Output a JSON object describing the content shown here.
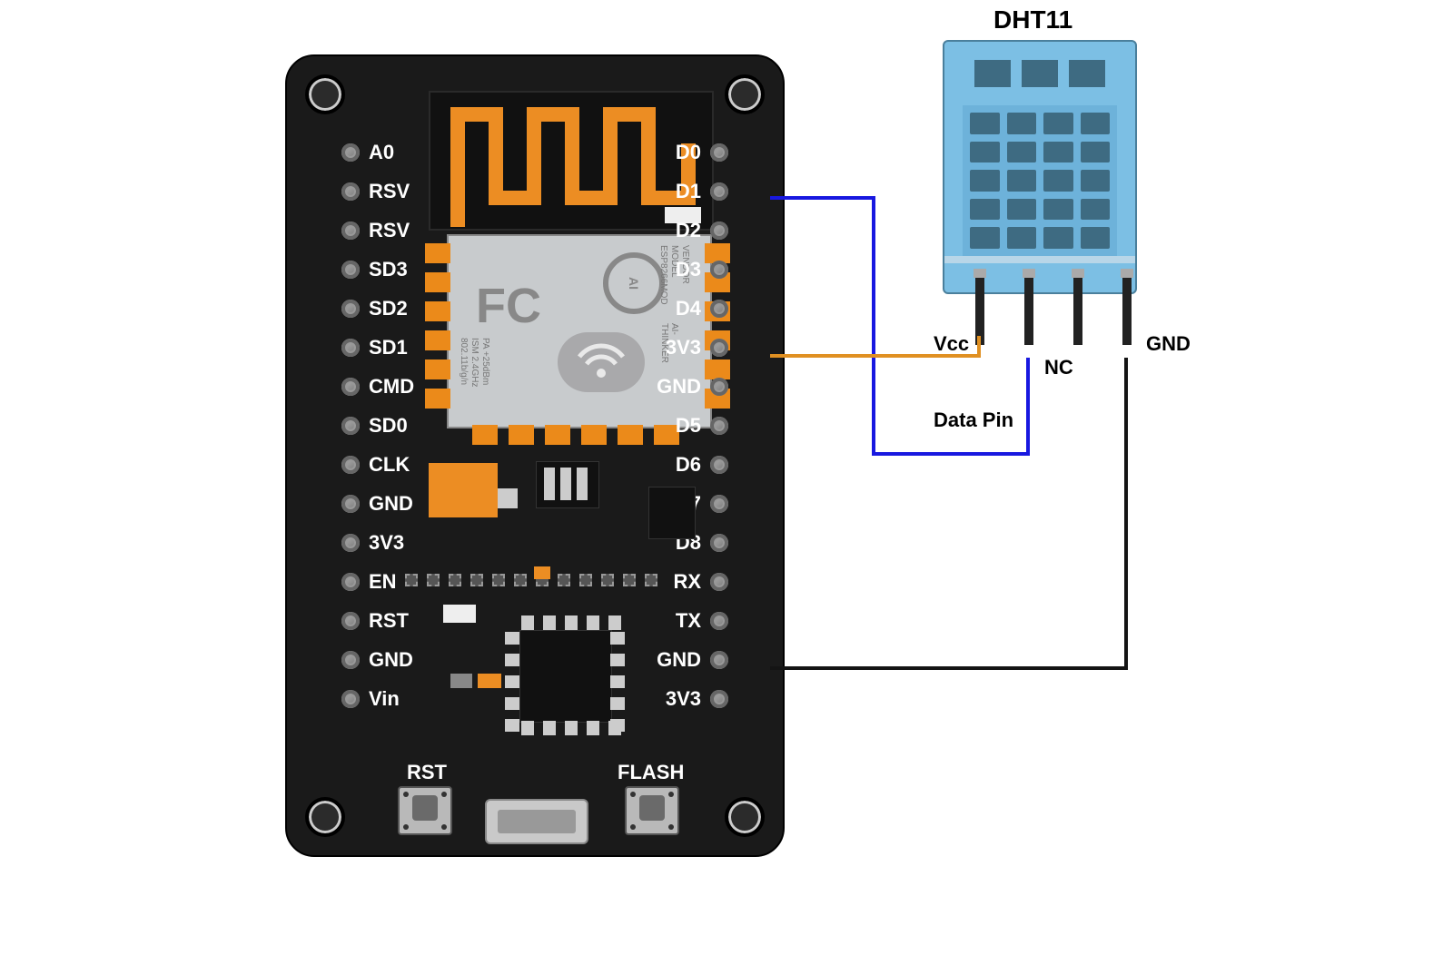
{
  "dht": {
    "title": "DHT11",
    "pins": [
      "Vcc",
      "Data",
      "NC",
      "GND"
    ]
  },
  "board": {
    "left_pins": [
      "A0",
      "RSV",
      "RSV",
      "SD3",
      "SD2",
      "SD1",
      "CMD",
      "SD0",
      "CLK",
      "GND",
      "3V3",
      "EN",
      "RST",
      "GND",
      "Vin"
    ],
    "right_pins": [
      "D0",
      "D1",
      "D2",
      "D3",
      "D4",
      "3V3",
      "GND",
      "D5",
      "D6",
      "D7",
      "D8",
      "RX",
      "TX",
      "GND",
      "3V3"
    ],
    "buttons": {
      "left": "RST",
      "right": "FLASH"
    },
    "shield": {
      "fcc": "FC",
      "wifi": "WiFi",
      "ai": "AI",
      "model_lines": [
        "MODEL",
        "VENDOR",
        "ESP8266MOD",
        "AI-THINKER",
        "ISM 2.4GHz",
        "PA +25dBm",
        "802.11b/g/n"
      ]
    }
  },
  "wires": {
    "d1": {
      "color": "#1818e0",
      "label": "Data Pin"
    },
    "v3": {
      "color": "#e09022",
      "label": "Vcc"
    },
    "gnd": {
      "color": "#141414",
      "label": "GND"
    }
  },
  "labels": {
    "nc": "NC"
  }
}
